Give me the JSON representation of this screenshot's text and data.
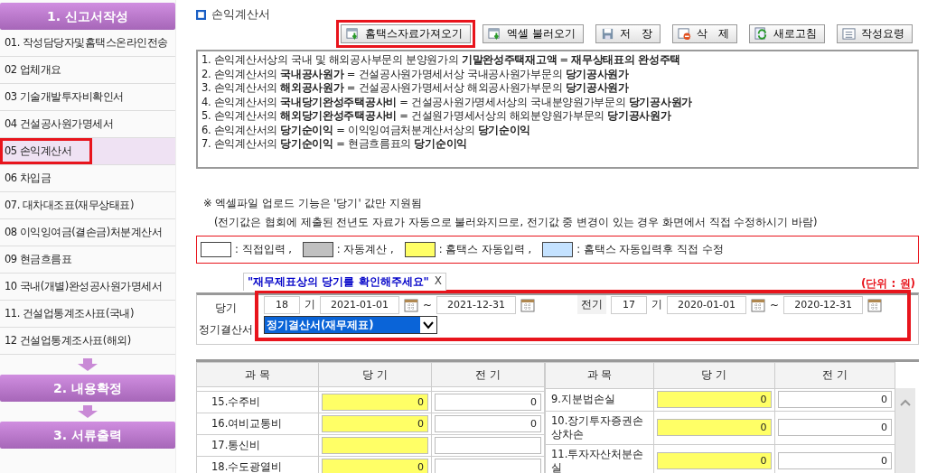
{
  "sidebar": {
    "steps": [
      {
        "label": "1. 신고서작성",
        "items": [
          {
            "label": "01. 작성담당자및홈택스온라인전송",
            "selected": false,
            "highlighted": false
          },
          {
            "label": "02 업체개요",
            "selected": false,
            "highlighted": false
          },
          {
            "label": "03 기술개발투자비확인서",
            "selected": false,
            "highlighted": false
          },
          {
            "label": "04 건설공사원가명세서",
            "selected": false,
            "highlighted": false
          },
          {
            "label": "05 손익계산서",
            "selected": true,
            "highlighted": true
          },
          {
            "label": "06 차입금",
            "selected": false,
            "highlighted": false
          },
          {
            "label": "07. 대차대조표(재무상태표)",
            "selected": false,
            "highlighted": false
          },
          {
            "label": "08 이익잉여금(결손금)처분계산서",
            "selected": false,
            "highlighted": false
          },
          {
            "label": "09 현금흐름표",
            "selected": false,
            "highlighted": false
          },
          {
            "label": "10 국내(개별)완성공사원가명세서",
            "selected": false,
            "highlighted": false
          },
          {
            "label": "11. 건설업통계조사표(국내)",
            "selected": false,
            "highlighted": false
          },
          {
            "label": "12 건설업통계조사표(해외)",
            "selected": false,
            "highlighted": false
          }
        ]
      },
      {
        "label": "2. 내용확정"
      },
      {
        "label": "3. 서류출력"
      }
    ]
  },
  "page_title": "손익계산서",
  "toolbar": [
    {
      "label": "홈택스자료가져오기",
      "highlighted": true
    },
    {
      "label": "엑셀 불러오기",
      "highlighted": false
    },
    {
      "label": "저　장",
      "highlighted": false
    },
    {
      "label": "삭　제",
      "highlighted": false
    },
    {
      "label": "새로고침",
      "highlighted": false
    },
    {
      "label": "작성요령",
      "highlighted": false
    }
  ],
  "notes": [
    "1. 손익계산서상의 국내 및 해외공사부문의 분양원가의 **기말완성주택재고액** = **재무상태표의 완성주택**",
    "2. 손익계산서의 **국내공사원가** = 건설공사원가명세서상 국내공사원가부문의 **당기공사원가**",
    "3. 손익계산서의 **해외공사원가** = 건설공사원가명세서상 해외공사원가부문의 **당기공사원가**",
    "4. 손익계산서의 **국내당기완성주택공사비** = 건설공사원가명세서상의 국내분양원가부문의 **당기공사원가**",
    "5. 손익계산서의 **해외당기완성주택공사비** = 건설원가명세서상의 해외분양원가부문의 **당기공사원가**",
    "6. 손익계산서의 **당기순이익** = 이익잉여금처분계산서상의 **당기순이익**",
    "7. 손익계산서의 **당기순이익** = 현금흐름표의 **당기순이익**"
  ],
  "notice": [
    "※ 엑셀파일 업로드 기능은 '당기' 값만 지원됨",
    "(전기값은 협회에 제출된 전년도 자료가 자동으로 불러와지므로, 전기값 중 변경이 있는 경우 화면에서 직접 수정하시기 바람)"
  ],
  "legend": [
    {
      "kind": "manual",
      "label": ": 직접입력 ,"
    },
    {
      "kind": "auto",
      "label": ": 자동계산 ,"
    },
    {
      "kind": "hometax",
      "label": ": 홈택스 자동입력 ,"
    },
    {
      "kind": "hometax_edited",
      "label": ": 홈택스 자동입력후 직접 수정"
    }
  ],
  "tooltip": {
    "text": "\"재무제표상의 당기를 확인해주세요\"",
    "close": "X"
  },
  "unit": "(단위 : 원)",
  "period": {
    "current": {
      "label": "당기",
      "term": "18",
      "term_unit": "기",
      "start": "2021-01-01",
      "tilde": "~",
      "end": "2021-12-31"
    },
    "previous": {
      "label": "전기",
      "term": "17",
      "term_unit": "기",
      "start": "2020-01-01",
      "tilde": "~",
      "end": "2020-12-31"
    },
    "statement_label": "정기결산서",
    "statement": "정기결산서(재무제표)",
    "highlighted": true
  },
  "tables": [
    {
      "columns": [
        "과 목",
        "당 기",
        "전 기"
      ],
      "rows": [
        {
          "subject": "15.수주비",
          "current": {
            "value": "0",
            "kind": "hometax"
          },
          "previous": {
            "value": "0",
            "kind": "manual"
          }
        },
        {
          "subject": "16.여비교통비",
          "current": {
            "value": "0",
            "kind": "hometax"
          },
          "previous": {
            "value": "0",
            "kind": "manual"
          }
        },
        {
          "subject": "17.통신비",
          "current": {
            "kind": "hometax"
          },
          "previous": {
            "kind": "manual"
          }
        },
        {
          "subject": "18.수도광열비",
          "current": {
            "value": "0",
            "kind": "hometax"
          },
          "previous": {
            "kind": "manual"
          }
        }
      ]
    },
    {
      "columns": [
        "과 목",
        "당 기",
        "전 기"
      ],
      "rows": [
        {
          "subject": "9.지분법손실",
          "current": {
            "value": "0",
            "kind": "hometax"
          },
          "previous": {
            "value": "0",
            "kind": "manual"
          }
        },
        {
          "subject": "10.장기투자증권손상차손",
          "current": {
            "value": "0",
            "kind": "hometax"
          },
          "previous": {
            "value": "0",
            "kind": "manual"
          }
        },
        {
          "subject": "11.투자자산처분손실",
          "current": {
            "value": "0",
            "kind": "hometax"
          },
          "previous": {
            "value": "0",
            "kind": "manual"
          }
        }
      ]
    }
  ]
}
